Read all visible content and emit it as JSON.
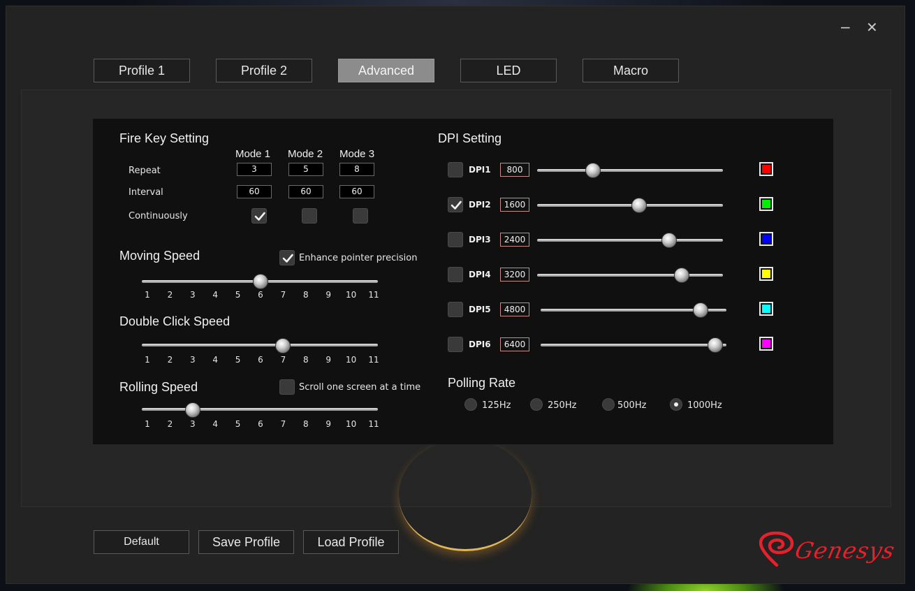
{
  "window": {
    "minimize_glyph": "−",
    "close_glyph": "✕"
  },
  "tabs": [
    {
      "label": "Profile 1",
      "active": false
    },
    {
      "label": "Profile 2",
      "active": false
    },
    {
      "label": "Advanced",
      "active": true
    },
    {
      "label": "LED",
      "active": false
    },
    {
      "label": "Macro",
      "active": false
    }
  ],
  "fire_key": {
    "title": "Fire Key Setting",
    "modes": [
      "Mode 1",
      "Mode 2",
      "Mode 3"
    ],
    "repeat_label": "Repeat",
    "repeat_values": [
      "3",
      "5",
      "8"
    ],
    "interval_label": "Interval",
    "interval_values": [
      "60",
      "60",
      "60"
    ],
    "continuously_label": "Continuously",
    "continuously_checked": [
      true,
      false,
      false
    ]
  },
  "moving_speed": {
    "title": "Moving Speed",
    "enhance_label": "Enhance pointer precision",
    "enhance_checked": true,
    "value": 6,
    "ticks": [
      "1",
      "2",
      "3",
      "4",
      "5",
      "6",
      "7",
      "8",
      "9",
      "10",
      "11"
    ]
  },
  "double_click": {
    "title": "Double Click Speed",
    "value": 7,
    "ticks": [
      "1",
      "2",
      "3",
      "4",
      "5",
      "6",
      "7",
      "8",
      "9",
      "10",
      "11"
    ]
  },
  "rolling_speed": {
    "title": "Rolling Speed",
    "scroll_label": "Scroll one screen at a time",
    "scroll_checked": false,
    "value": 3,
    "ticks": [
      "1",
      "2",
      "3",
      "4",
      "5",
      "6",
      "7",
      "8",
      "9",
      "10",
      "11"
    ]
  },
  "dpi": {
    "title": "DPI Setting",
    "items": [
      {
        "label": "DPI1",
        "value": "800",
        "checked": false,
        "level": 0.3,
        "color": "#ff0000"
      },
      {
        "label": "DPI2",
        "value": "1600",
        "checked": true,
        "level": 0.55,
        "color": "#00ee00"
      },
      {
        "label": "DPI3",
        "value": "2400",
        "checked": false,
        "level": 0.71,
        "color": "#0000ff"
      },
      {
        "label": "DPI4",
        "value": "3200",
        "checked": false,
        "level": 0.78,
        "color": "#ffff00"
      },
      {
        "label": "DPI5",
        "value": "4800",
        "checked": false,
        "level": 0.86,
        "color": "#00ffff"
      },
      {
        "label": "DPI6",
        "value": "6400",
        "checked": false,
        "level": 0.94,
        "color": "#ff00ff"
      }
    ]
  },
  "polling": {
    "title": "Polling Rate",
    "options": [
      {
        "label": "125Hz",
        "selected": false
      },
      {
        "label": "250Hz",
        "selected": false
      },
      {
        "label": "500Hz",
        "selected": false
      },
      {
        "label": "1000Hz",
        "selected": true
      }
    ]
  },
  "bottom": {
    "default_label": "Default",
    "save_label": "Save Profile",
    "load_label": "Load Profile"
  },
  "brand": {
    "logo_text": "Genesys",
    "logo_color": "#e5212b",
    "logo_icon": "genesis-spiral-icon"
  }
}
